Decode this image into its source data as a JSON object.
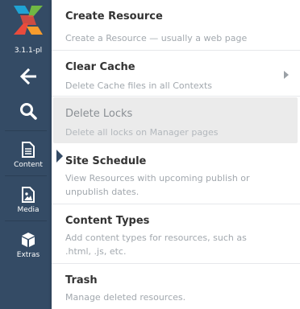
{
  "sidebar": {
    "version": "3.1.1-pl",
    "items": [
      {
        "label": "Content",
        "icon": "file-icon",
        "active": true
      },
      {
        "label": "Media",
        "icon": "image-file-icon"
      },
      {
        "label": "Extras",
        "icon": "cube-icon"
      }
    ]
  },
  "menu": {
    "items": [
      {
        "title": "Create Resource",
        "desc": "Create a Resource — usually a web page"
      },
      {
        "title": "Clear Cache",
        "desc": "Delete Cache files in all Contexts",
        "has_submenu": true
      },
      {
        "title": "Delete Locks",
        "desc": "Delete all locks on Manager pages",
        "disabled": true
      },
      {
        "title": "Site Schedule",
        "desc": "View Resources with upcoming publish or unpublish dates."
      },
      {
        "title": "Content Types",
        "desc": "Add content types for resources, such as .html, .js, etc."
      },
      {
        "title": "Trash",
        "desc": "Manage deleted resources."
      }
    ]
  },
  "colors": {
    "sidebar_bg": "#344b65",
    "logo_blue": "#1fa3d3",
    "logo_orange": "#f79c2d",
    "logo_red": "#e94b3c",
    "logo_green": "#70b844"
  }
}
